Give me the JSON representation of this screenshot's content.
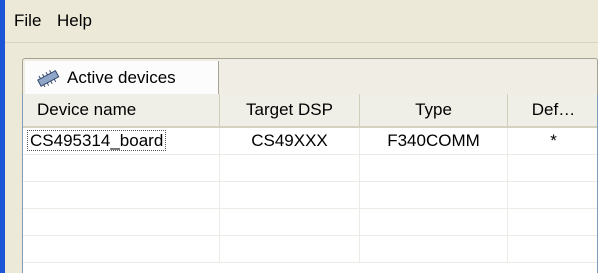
{
  "menu": {
    "file": "File",
    "help": "Help"
  },
  "tabs": [
    {
      "label": "Active devices",
      "icon": "chip-icon"
    }
  ],
  "table": {
    "columns": [
      "Device name",
      "Target DSP",
      "Type",
      "Def…"
    ],
    "rows": [
      [
        "CS495314_board",
        "CS49XXX",
        "F340COMM",
        "*"
      ]
    ],
    "empty_rows": 4
  },
  "colors": {
    "window_bg": "#ece9d8",
    "accent_edge": "#1c56d6",
    "grid_line": "#ecece6",
    "header_bg": "#f0efe7"
  }
}
